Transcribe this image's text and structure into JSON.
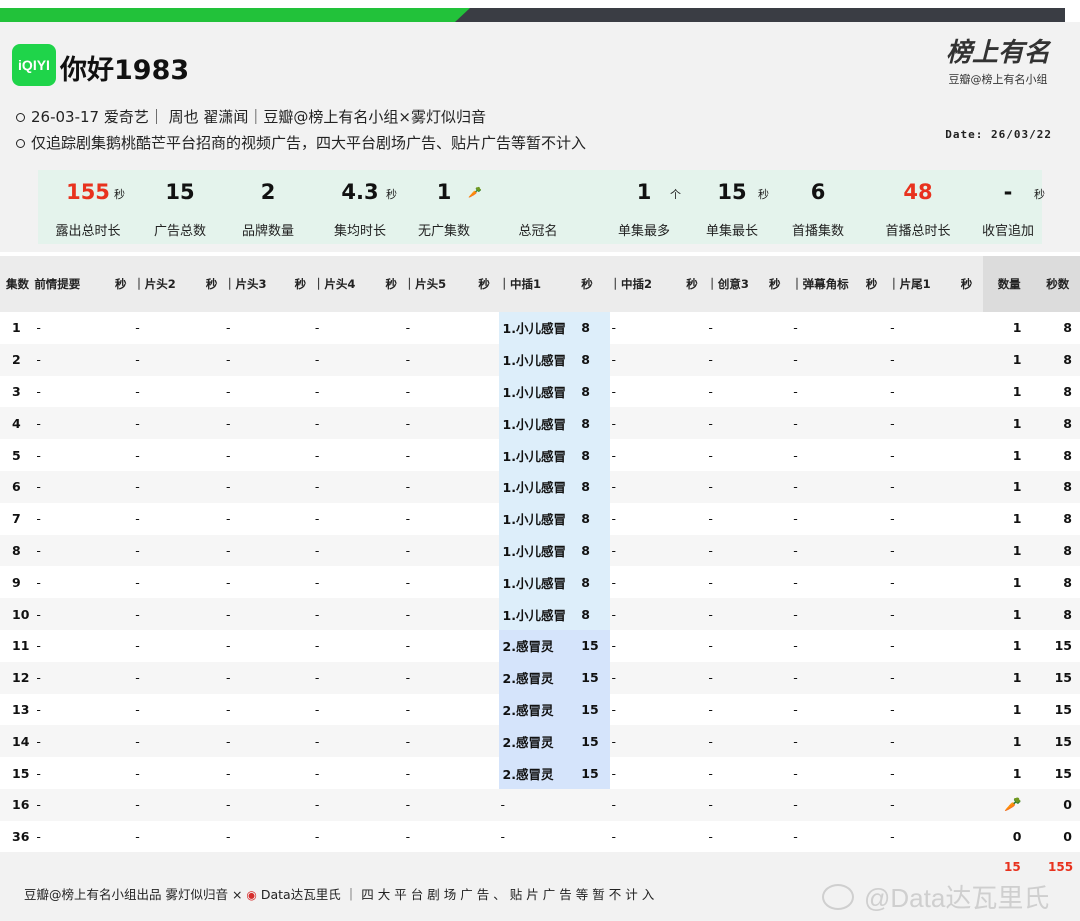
{
  "header": {
    "logo_text": "iQIYI",
    "title": "你好1983",
    "brand_signature": "榜上有名",
    "brand_sub": "豆瓣@榜上有名小组",
    "info_line1": "26-03-17 爱奇艺｜ 周也 翟潇闻｜豆瓣@榜上有名小组×雾灯似归音",
    "info_line2": "仅追踪剧集鹅桃酷芒平台招商的视频广告，四大平台剧场广告、贴片广告等暂不计入",
    "date": "Date: 26/03/22"
  },
  "stats": [
    {
      "value": "155",
      "unit": "秒",
      "label": "露出总时长",
      "red": true
    },
    {
      "value": "15",
      "unit": "",
      "label": "广告总数",
      "red": false
    },
    {
      "value": "2",
      "unit": "",
      "label": "品牌数量",
      "red": false
    },
    {
      "value": "4.3",
      "unit": "秒",
      "label": "集均时长",
      "red": false
    },
    {
      "value": "1",
      "unit": "",
      "label": "无广集数",
      "red": false,
      "carrot": true
    },
    {
      "value": "",
      "unit": "",
      "label": "总冠名",
      "red": false
    },
    {
      "value": "1",
      "unit": "个",
      "label": "单集最多",
      "red": false
    },
    {
      "value": "15",
      "unit": "秒",
      "label": "单集最长",
      "red": false
    },
    {
      "value": "6",
      "unit": "",
      "label": "首播集数",
      "red": false
    },
    {
      "value": "48",
      "unit": "",
      "label": "首播总时长",
      "red": true
    },
    {
      "value": "-",
      "unit": "秒",
      "label": "收官追加",
      "red": false
    }
  ],
  "table": {
    "columns": [
      "集数",
      "前情提要",
      "秒",
      "｜片头2",
      "秒",
      "｜片头3",
      "秒",
      "｜片头4",
      "秒",
      "｜片头5",
      "秒",
      "｜中插1",
      "秒",
      "｜中插2",
      "秒",
      "｜创意3",
      "秒",
      "｜弹幕角标",
      "秒",
      "｜片尾1",
      "秒",
      "数量",
      "秒数"
    ],
    "rows": [
      {
        "ep": "1",
        "mid": "1.小儿感冒",
        "mid_sec": "8",
        "count": "1",
        "secs": "8",
        "band": "a"
      },
      {
        "ep": "2",
        "mid": "1.小儿感冒",
        "mid_sec": "8",
        "count": "1",
        "secs": "8",
        "band": "a"
      },
      {
        "ep": "3",
        "mid": "1.小儿感冒",
        "mid_sec": "8",
        "count": "1",
        "secs": "8",
        "band": "a"
      },
      {
        "ep": "4",
        "mid": "1.小儿感冒",
        "mid_sec": "8",
        "count": "1",
        "secs": "8",
        "band": "a"
      },
      {
        "ep": "5",
        "mid": "1.小儿感冒",
        "mid_sec": "8",
        "count": "1",
        "secs": "8",
        "band": "a"
      },
      {
        "ep": "6",
        "mid": "1.小儿感冒",
        "mid_sec": "8",
        "count": "1",
        "secs": "8",
        "band": "a"
      },
      {
        "ep": "7",
        "mid": "1.小儿感冒",
        "mid_sec": "8",
        "count": "1",
        "secs": "8",
        "band": "a"
      },
      {
        "ep": "8",
        "mid": "1.小儿感冒",
        "mid_sec": "8",
        "count": "1",
        "secs": "8",
        "band": "a"
      },
      {
        "ep": "9",
        "mid": "1.小儿感冒",
        "mid_sec": "8",
        "count": "1",
        "secs": "8",
        "band": "a"
      },
      {
        "ep": "10",
        "mid": "1.小儿感冒",
        "mid_sec": "8",
        "count": "1",
        "secs": "8",
        "band": "a"
      },
      {
        "ep": "11",
        "mid": "2.感冒灵",
        "mid_sec": "15",
        "count": "1",
        "secs": "15",
        "band": "b"
      },
      {
        "ep": "12",
        "mid": "2.感冒灵",
        "mid_sec": "15",
        "count": "1",
        "secs": "15",
        "band": "b"
      },
      {
        "ep": "13",
        "mid": "2.感冒灵",
        "mid_sec": "15",
        "count": "1",
        "secs": "15",
        "band": "b"
      },
      {
        "ep": "14",
        "mid": "2.感冒灵",
        "mid_sec": "15",
        "count": "1",
        "secs": "15",
        "band": "b"
      },
      {
        "ep": "15",
        "mid": "2.感冒灵",
        "mid_sec": "15",
        "count": "1",
        "secs": "15",
        "band": "b"
      },
      {
        "ep": "16",
        "mid": "-",
        "mid_sec": "",
        "count": "",
        "secs": "0",
        "band": "",
        "carrot": true
      },
      {
        "ep": "36",
        "mid": "-",
        "mid_sec": "",
        "count": "0",
        "secs": "0",
        "band": ""
      }
    ],
    "dash": "-"
  },
  "footer": {
    "text_a": "豆瓣@榜上有名小组出品  雾灯似归音 ×",
    "text_b": "Data达瓦里氏 ｜",
    "text_c": "四大平台剧场广告、贴片广告等暂不计入",
    "total_count": "15",
    "total_secs": "155"
  },
  "watermark": "@Data达瓦里氏"
}
